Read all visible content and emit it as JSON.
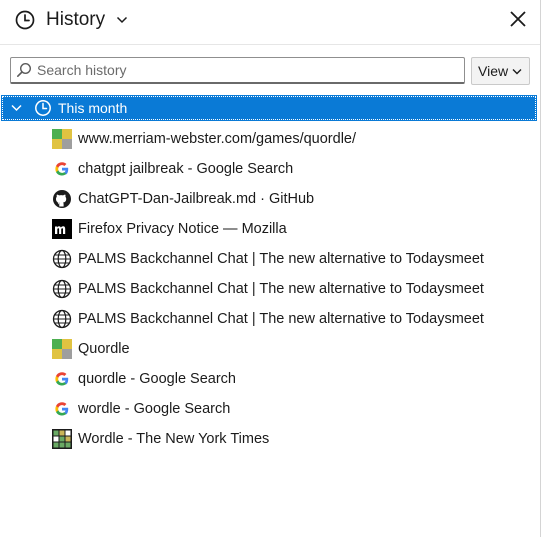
{
  "header": {
    "title": "History"
  },
  "search": {
    "placeholder": "Search history"
  },
  "view_button": {
    "label": "View"
  },
  "group": {
    "label": "This month"
  },
  "items": [
    {
      "title": "www.merriam-webster.com/games/quordle/",
      "icon": "quordle-favicon-icon"
    },
    {
      "title": "chatgpt jailbreak - Google Search",
      "icon": "google-icon"
    },
    {
      "title": "ChatGPT-Dan-Jailbreak.md · GitHub",
      "icon": "github-icon"
    },
    {
      "title": "Firefox Privacy Notice — Mozilla",
      "icon": "mozilla-icon"
    },
    {
      "title": "PALMS Backchannel Chat | The new alternative to Todaysmeet",
      "icon": "globe-icon"
    },
    {
      "title": "PALMS Backchannel Chat | The new alternative to Todaysmeet",
      "icon": "globe-icon"
    },
    {
      "title": "PALMS Backchannel Chat | The new alternative to Todaysmeet",
      "icon": "globe-icon"
    },
    {
      "title": "Quordle",
      "icon": "quordle-favicon-icon"
    },
    {
      "title": "quordle - Google Search",
      "icon": "google-icon"
    },
    {
      "title": "wordle - Google Search",
      "icon": "google-icon"
    },
    {
      "title": "Wordle - The New York Times",
      "icon": "wordle-icon"
    }
  ],
  "colors": {
    "selection": "#0a7ad6",
    "text": "#1b1b1b"
  }
}
